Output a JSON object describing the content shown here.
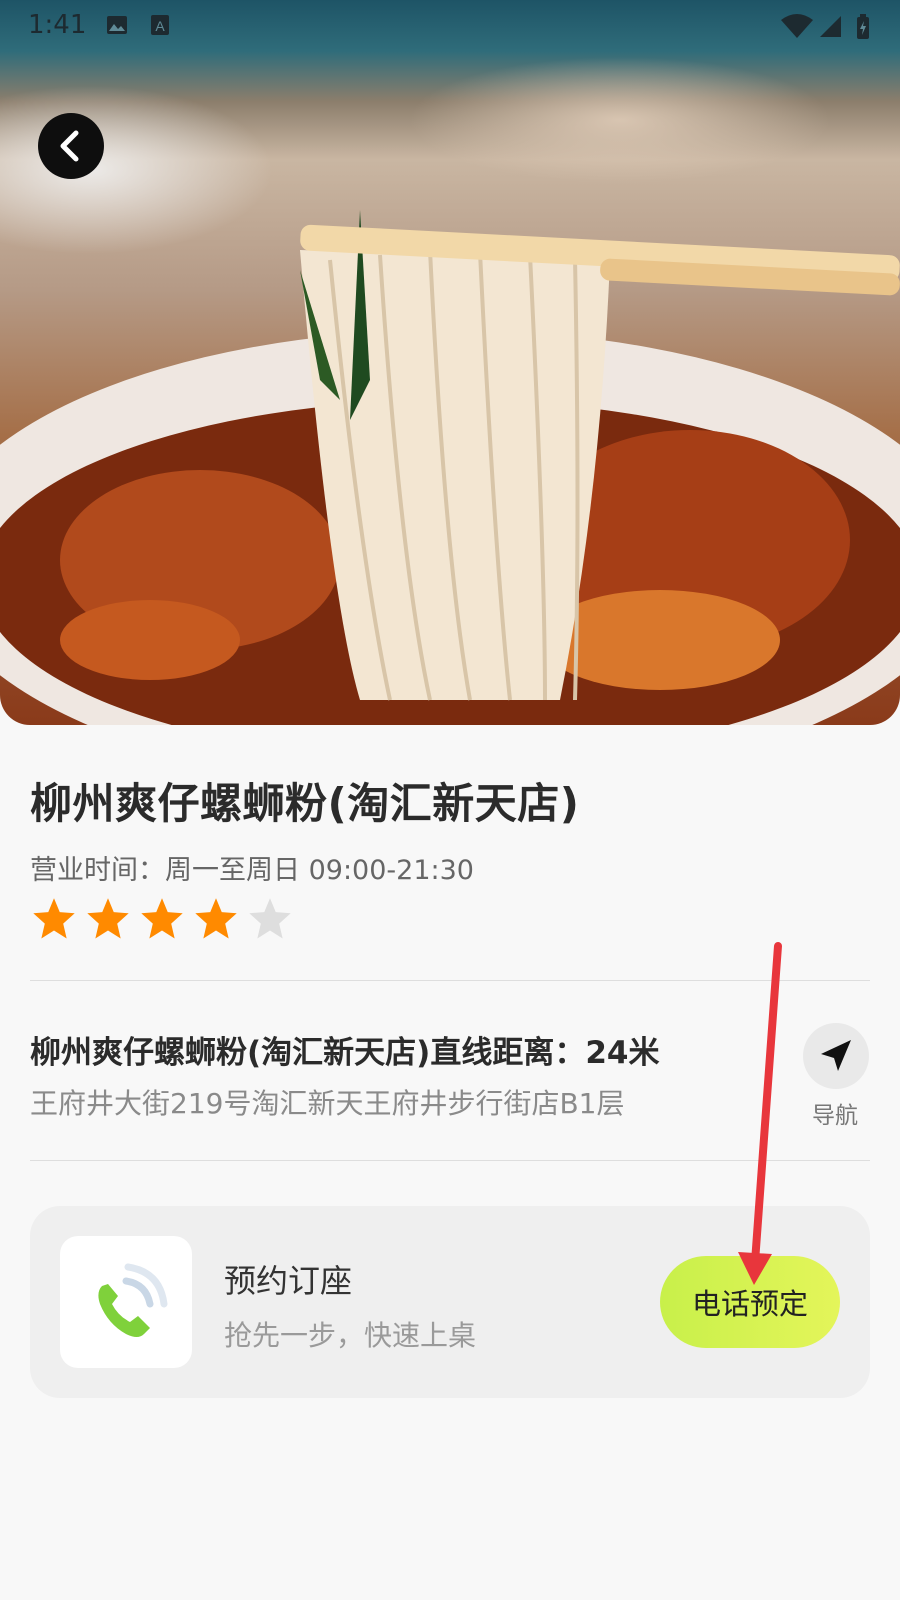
{
  "status_bar": {
    "time": "1:41",
    "icons": [
      "image-icon",
      "text-a-icon",
      "wifi-icon",
      "signal-icon",
      "battery-icon"
    ]
  },
  "hero": {
    "image": "noodle-dish-photo"
  },
  "restaurant": {
    "name": "柳州爽仔螺蛳粉(淘汇新天店)",
    "hours": "营业时间：周一至周日 09:00-21:30",
    "rating": 4,
    "rating_max": 5
  },
  "location": {
    "distance_line": "柳州爽仔螺蛳粉(淘汇新天店)直线距离：24米",
    "address": "王府井大街219号淘汇新天王府井步行街店B1层",
    "nav_label": "导航"
  },
  "reservation": {
    "title": "预约订座",
    "subtitle": "抢先一步，快速上桌",
    "call_button": "电话预定"
  },
  "colors": {
    "star_filled": "#ff8a00",
    "star_empty": "#dedede",
    "call_button_gradient": [
      "#c8f04a",
      "#e4f55a"
    ],
    "annotation_arrow": "#e8363c"
  }
}
